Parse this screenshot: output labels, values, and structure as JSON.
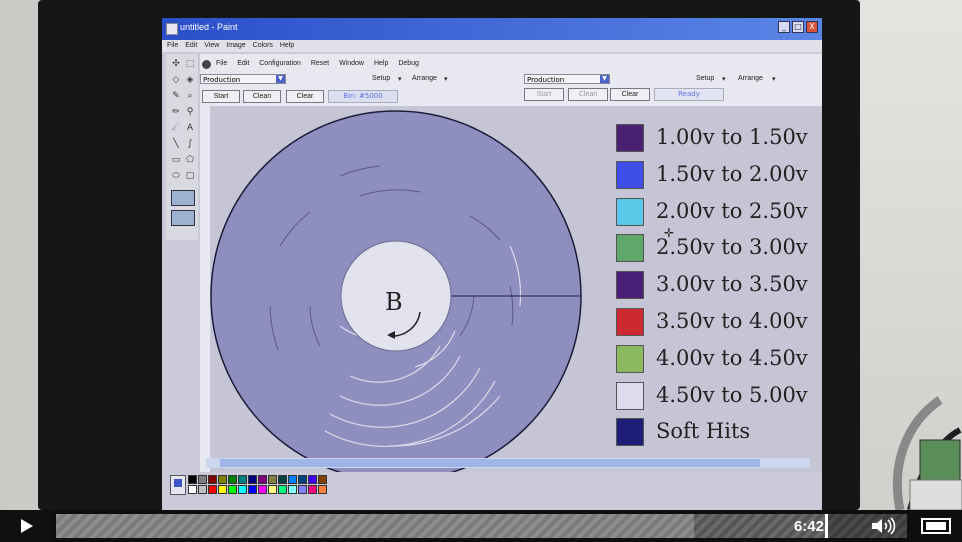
{
  "window": {
    "title": "untitled - Paint",
    "min_label": "_",
    "max_label": "□",
    "close_label": "X"
  },
  "menu": [
    "File",
    "Edit",
    "View",
    "Image",
    "Colors",
    "Help"
  ],
  "inner_menu": [
    "File",
    "Edit",
    "Configuration",
    "Reset",
    "Window",
    "Help",
    "Debug"
  ],
  "left_panel": {
    "mode_select": "Production",
    "setup_label": "Setup",
    "arrange_label": "Arrange",
    "start_label": "Start",
    "clean_label": "Clean",
    "clear_label": "Clear",
    "status": "Bin: #5000"
  },
  "right_panel": {
    "mode_select": "Production",
    "setup_label": "Setup",
    "arrange_label": "Arrange",
    "start_label": "Start",
    "clean_label": "Clean",
    "clear_label": "Clear",
    "status": "Ready"
  },
  "disk": {
    "center_label": "B"
  },
  "legend": [
    {
      "label": "1.00v to 1.50v",
      "color": "#4a2070"
    },
    {
      "label": "1.50v to 2.00v",
      "color": "#3d4fe8"
    },
    {
      "label": "2.00v to 2.50v",
      "color": "#5ac8e8"
    },
    {
      "label": "2.50v to 3.00v",
      "color": "#5fa86a"
    },
    {
      "label": "3.00v to 3.50v",
      "color": "#4a1f78"
    },
    {
      "label": "3.50v to 4.00v",
      "color": "#cc2a30"
    },
    {
      "label": "4.00v to 4.50v",
      "color": "#8ab860"
    },
    {
      "label": "4.50v to 5.00v",
      "color": "#dcdcee"
    },
    {
      "label": "Soft Hits",
      "color": "#1e1e78"
    }
  ],
  "palette_colors": [
    "#000000",
    "#808080",
    "#800000",
    "#808000",
    "#008000",
    "#008080",
    "#000080",
    "#800080",
    "#808040",
    "#004040",
    "#0080ff",
    "#004080",
    "#4000ff",
    "#804000",
    "#ffffff",
    "#c0c0c0",
    "#ff0000",
    "#ffff00",
    "#00ff00",
    "#00ffff",
    "#0000ff",
    "#ff00ff",
    "#ffff80",
    "#00ff80",
    "#80ffff",
    "#8080ff",
    "#ff0080",
    "#ff8040"
  ],
  "video": {
    "time": "6:42",
    "played_fraction": 0.79
  }
}
